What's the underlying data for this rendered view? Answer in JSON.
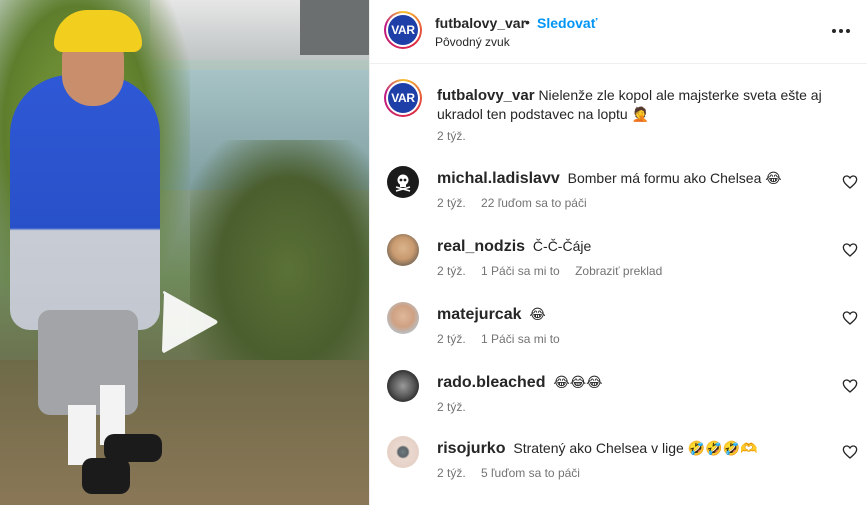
{
  "post": {
    "username": "futbalovy_var",
    "separator": "•",
    "follow_label": "Sledovať",
    "audio_label": "Pôvodný zvuk",
    "avatar_text": "VAR"
  },
  "caption": {
    "username": "futbalovy_var",
    "text": "Nielenže zle kopol ale majsterke sveta ešte aj ukradol ten podstavec na loptu 🤦",
    "time": "2 týž."
  },
  "comments": [
    {
      "username": "michal.ladislavv",
      "text": "Bomber má formu ako Chelsea 😂",
      "time": "2 týž.",
      "likes": "22 ľuďom sa to páči",
      "translate": ""
    },
    {
      "username": "real_nodzis",
      "text": "Č-Č-Čáje",
      "time": "2 týž.",
      "likes": "1 Páči sa mi to",
      "translate": "Zobraziť preklad"
    },
    {
      "username": "matejurcak",
      "text": "😂",
      "time": "2 týž.",
      "likes": "1 Páči sa mi to",
      "translate": ""
    },
    {
      "username": "rado.bleached",
      "text": "😂😂😂",
      "time": "2 týž.",
      "likes": "",
      "translate": ""
    },
    {
      "username": "risojurko",
      "text": "Stratený ako Chelsea v lige 🤣🤣🤣🫶",
      "time": "2 týž.",
      "likes": "5 ľuďom sa to páči",
      "translate": ""
    }
  ],
  "icons": {
    "more": "more-horizontal-icon",
    "heart": "heart-outline-icon",
    "play": "play-icon"
  },
  "colors": {
    "link_blue": "#0095f6",
    "muted": "#737373",
    "text": "#262626"
  }
}
